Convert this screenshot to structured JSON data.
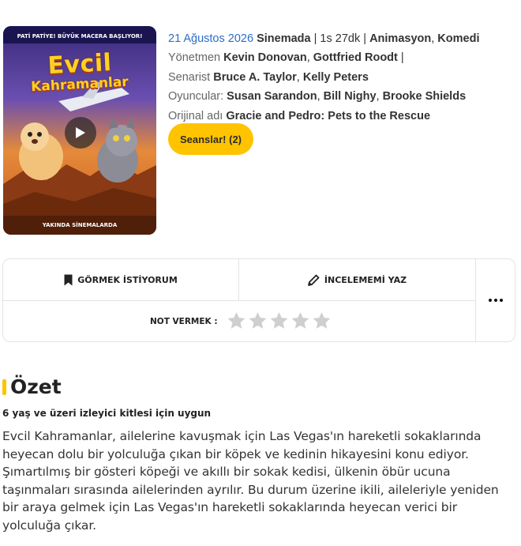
{
  "poster": {
    "banner": "PATİ PATİYE! BÜYÜK MACERA BAŞLIYOR!",
    "title_line1": "Evcil",
    "title_line2": "Kahramanlar",
    "footer": "YAKINDA SİNEMALARDA",
    "play_icon": "play-icon"
  },
  "info": {
    "release_date": "21 Ağustos 2026",
    "release_suffix": "Sinemada",
    "duration": "1s 27dk",
    "genres": [
      "Animasyon",
      "Komedi"
    ],
    "director_label": "Yönetmen",
    "directors": [
      "Kevin Donovan",
      "Gottfried Roodt"
    ],
    "writer_label": "Senarist",
    "writers": [
      "Bruce A. Taylor",
      "Kelly Peters"
    ],
    "cast_label": "Oyuncular:",
    "cast": [
      "Susan Sarandon",
      "Bill Nighy",
      "Brooke Shields"
    ],
    "original_title_label": "Orijinal adı",
    "original_title": "Gracie and Pedro: Pets to the Rescue"
  },
  "sessions_button": "Seanslar! (2)",
  "actions": {
    "want_to_see": "GÖRMEK İSTİYORUM",
    "write_review": "İNCELEMEMİ YAZ",
    "more_icon": "more-horizontal-icon",
    "rate_label": "NOT VERMEK :",
    "star_count": 5,
    "rating_value": 0
  },
  "summary": {
    "heading": "Özet",
    "age_note": "6 yaş ve üzeri izleyici kitlesi için uygun",
    "text": "Evcil Kahramanlar, ailelerine kavuşmak için Las Vegas'ın hareketli sokaklarında heyecan dolu bir yolculuğa çıkan bir köpek ve kedinin hikayesini konu ediyor. Şımartılmış bir gösteri köpeği ve akıllı bir sokak kedisi, ülkenin öbür ucuna taşınmaları sırasında ailelerinden ayrılır. Bu durum üzerine ikili, aileleriyle yeniden bir araya gelmek için Las Vegas'ın hareketli sokaklarında heyecan verici bir yolculuğa çıkar."
  },
  "colors": {
    "accent": "#ffc300",
    "link": "#2a6ec6",
    "border": "#e3e3e3",
    "star_empty": "#cfcfcf"
  }
}
